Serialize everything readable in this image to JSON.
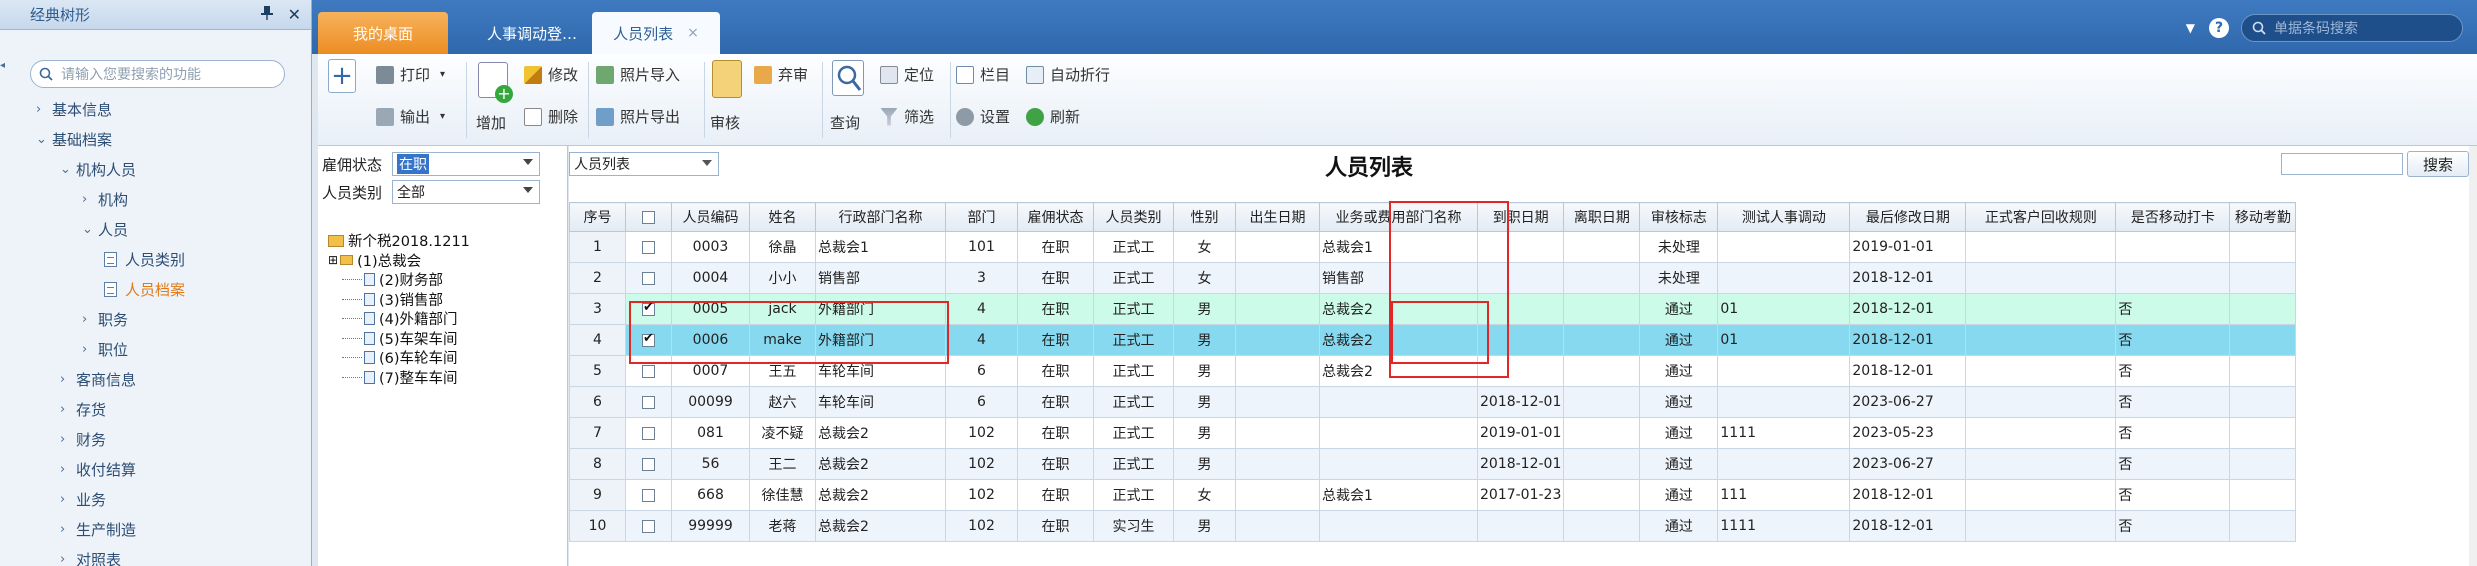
{
  "left": {
    "title": "经典树形",
    "pin_icon": "pin-icon",
    "close_icon": "close-icon",
    "search_placeholder": "请输入您要搜索的功能",
    "tree": [
      {
        "label": "基本信息",
        "level": 1,
        "arrow": "›"
      },
      {
        "label": "基础档案",
        "level": 1,
        "arrow": "⌄"
      },
      {
        "label": "机构人员",
        "level": 2,
        "arrow": "⌄"
      },
      {
        "label": "机构",
        "level": 3,
        "arrow": "›"
      },
      {
        "label": "人员",
        "level": 3,
        "arrow": "⌄"
      },
      {
        "label": "人员类别",
        "level": 4,
        "arrow": "doc"
      },
      {
        "label": "人员档案",
        "level": 4,
        "arrow": "doc",
        "selected": true
      },
      {
        "label": "职务",
        "level": 3,
        "arrow": "›"
      },
      {
        "label": "职位",
        "level": 3,
        "arrow": "›"
      },
      {
        "label": "客商信息",
        "level": 2,
        "arrow": "›"
      },
      {
        "label": "存货",
        "level": 2,
        "arrow": "›"
      },
      {
        "label": "财务",
        "level": 2,
        "arrow": "›"
      },
      {
        "label": "收付结算",
        "level": 2,
        "arrow": "›"
      },
      {
        "label": "业务",
        "level": 2,
        "arrow": "›"
      },
      {
        "label": "生产制造",
        "level": 2,
        "arrow": "›"
      },
      {
        "label": "对照表",
        "level": 2,
        "arrow": "›"
      }
    ]
  },
  "tabs": {
    "home": "我的桌面",
    "t2": "人事调动登…",
    "t3": "人员列表",
    "close": "×"
  },
  "topsearch": {
    "placeholder": "单据条码搜索"
  },
  "ribbon": {
    "print": "打印",
    "output": "输出",
    "add": "增加",
    "edit": "修改",
    "delete": "删除",
    "photo_import": "照片导入",
    "photo_export": "照片导出",
    "audit": "审核",
    "abandon": "弃审",
    "query": "查询",
    "locate": "定位",
    "filter": "筛选",
    "columns": "栏目",
    "wrap": "自动折行",
    "settings": "设置",
    "refresh": "刷新"
  },
  "filters": {
    "employ_label": "雇佣状态",
    "employ_value": "在职",
    "type_label": "人员类别",
    "type_value": "全部"
  },
  "org_tree": [
    "新个税2018.1211",
    "(1)总裁会",
    "(2)财务部",
    "(3)销售部",
    "(4)外籍部门",
    "(5)车架车间",
    "(6)车轮车间",
    "(7)整车车间"
  ],
  "main": {
    "view_select": "人员列表",
    "title": "人员列表",
    "search_button": "搜索"
  },
  "table": {
    "headers": [
      "序号",
      "",
      "人员编码",
      "姓名",
      "行政部门名称",
      "部门",
      "雇佣状态",
      "人员类别",
      "性别",
      "出生日期",
      "业务或费用部门名称",
      "到职日期",
      "离职日期",
      "审核标志",
      "测试人事调动",
      "最后修改日期",
      "正式客户回收规则",
      "是否移动打卡",
      "移动考勤"
    ],
    "rows": [
      [
        "1",
        "",
        "0003",
        "徐晶",
        "总裁会1",
        "101",
        "在职",
        "正式工",
        "女",
        "",
        "总裁会1",
        "",
        "",
        "未处理",
        "",
        "2019-01-01",
        "",
        "",
        ""
      ],
      [
        "2",
        "",
        "0004",
        "小小",
        "销售部",
        "3",
        "在职",
        "正式工",
        "女",
        "",
        "销售部",
        "",
        "",
        "未处理",
        "",
        "2018-12-01",
        "",
        "",
        ""
      ],
      [
        "3",
        "on",
        "0005",
        "jack",
        "外籍部门",
        "4",
        "在职",
        "正式工",
        "男",
        "",
        "总裁会2",
        "",
        "",
        "通过",
        "01",
        "2018-12-01",
        "",
        "否",
        ""
      ],
      [
        "4",
        "on",
        "0006",
        "make",
        "外籍部门",
        "4",
        "在职",
        "正式工",
        "男",
        "",
        "总裁会2",
        "",
        "",
        "通过",
        "01",
        "2018-12-01",
        "",
        "否",
        ""
      ],
      [
        "5",
        "",
        "0007",
        "王五",
        "车轮车间",
        "6",
        "在职",
        "正式工",
        "男",
        "",
        "总裁会2",
        "",
        "",
        "通过",
        "",
        "2018-12-01",
        "",
        "否",
        ""
      ],
      [
        "6",
        "",
        "00099",
        "赵六",
        "车轮车间",
        "6",
        "在职",
        "正式工",
        "男",
        "",
        "",
        "2018-12-01",
        "",
        "通过",
        "",
        "2023-06-27",
        "",
        "否",
        ""
      ],
      [
        "7",
        "",
        "081",
        "凌不疑",
        "总裁会2",
        "102",
        "在职",
        "正式工",
        "男",
        "",
        "",
        "2019-01-01",
        "",
        "通过",
        "1111",
        "2023-05-23",
        "",
        "否",
        ""
      ],
      [
        "8",
        "",
        "56",
        "王二",
        "总裁会2",
        "102",
        "在职",
        "正式工",
        "男",
        "",
        "",
        "2018-12-01",
        "",
        "通过",
        "",
        "2023-06-27",
        "",
        "否",
        ""
      ],
      [
        "9",
        "",
        "668",
        "徐佳慧",
        "总裁会2",
        "102",
        "在职",
        "正式工",
        "女",
        "",
        "总裁会1",
        "2017-01-23",
        "",
        "通过",
        "111",
        "2018-12-01",
        "",
        "否",
        ""
      ],
      [
        "10",
        "",
        "99999",
        "老蒋",
        "总裁会2",
        "102",
        "在职",
        "实习生",
        "男",
        "",
        "",
        "",
        "",
        "通过",
        "1111",
        "2018-12-01",
        "",
        "否",
        ""
      ]
    ]
  },
  "colors": {
    "accent": "#2f68ac",
    "home_tab": "#ec8d23",
    "highlight_row": "#87d9f0",
    "checked_row": "#cdfbea",
    "red_box": "#e02828"
  }
}
